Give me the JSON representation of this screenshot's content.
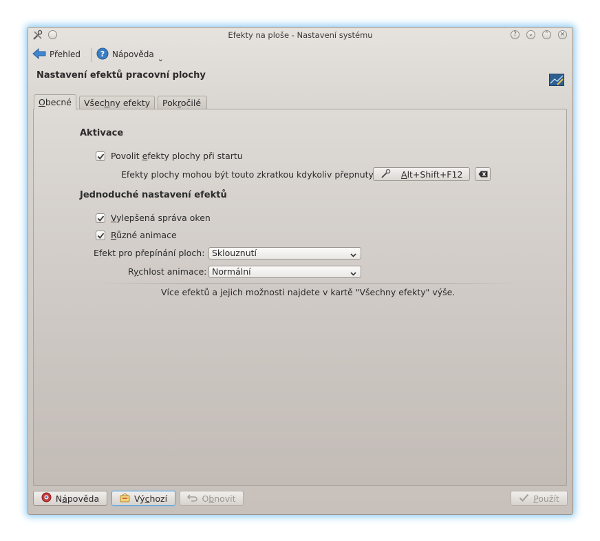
{
  "window": {
    "title": "Efekty na ploše - Nastavení systému",
    "controls": [
      "?",
      "⌄",
      "⌃",
      "×"
    ]
  },
  "toolbar": {
    "overview_label": "Přehled",
    "help_label": "Nápověda",
    "help_dropdown": "⌄"
  },
  "page": {
    "title": "Nastavení efektů pracovní plochy"
  },
  "tabs": [
    {
      "label": "Obecné",
      "accel": "O",
      "rest": "becné",
      "active": true
    },
    {
      "label": "Všechny efekty",
      "pre": "Všec",
      "accel": "h",
      "rest": "ny efekty",
      "active": false
    },
    {
      "label": "Pokročilé",
      "pre": "Pok",
      "accel": "r",
      "rest": "očilé",
      "active": false
    }
  ],
  "activation": {
    "title": "Aktivace",
    "enable_checkbox": {
      "pre": "Povolit ",
      "accel": "e",
      "rest": "fekty plochy při startu",
      "checked": true
    },
    "shortcut_text": "Efekty plochy mohou být touto zkratkou kdykoliv přepnuty:",
    "shortcut": {
      "accel": "A",
      "rest": "lt+Shift+F12"
    }
  },
  "simple": {
    "title": "Jednoduché nastavení efektů",
    "window_mgmt": {
      "accel": "V",
      "rest": "ylepšená správa oken",
      "checked": true
    },
    "animations": {
      "accel": "R",
      "rest": "ůzné animace",
      "checked": true
    },
    "desktop_switch": {
      "label": "Efekt pro přepínání ploch:",
      "value": "Sklouznutí"
    },
    "anim_speed": {
      "pre": "R",
      "accel": "y",
      "rest": "chlost animace:",
      "value": "Normální"
    },
    "more_info": "Více efektů a jejich možnosti najdete v kartě \"Všechny efekty\" výše."
  },
  "buttons": {
    "help": {
      "pre": "N",
      "accel": "á",
      "rest": "pověda"
    },
    "defaults": {
      "pre": "Vý",
      "accel": "c",
      "rest": "hozí"
    },
    "reset": {
      "pre": "O",
      "accel": "b",
      "rest": "novit"
    },
    "apply": {
      "accel": "P",
      "rest": "oužít"
    }
  },
  "colors": {
    "accent": "#62a7db",
    "window_glow": "#6ebef0"
  }
}
